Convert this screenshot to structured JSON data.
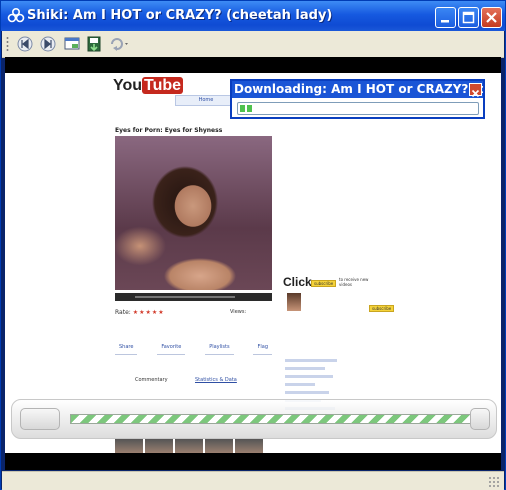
{
  "window": {
    "title": "Shiki: Am I HOT or CRAZY? (cheetah lady)"
  },
  "toolbar": {
    "icons": [
      "prev-icon",
      "next-icon",
      "picture-in-picture-icon",
      "save-icon",
      "refresh-icon"
    ]
  },
  "video_frame": {
    "logo_you": "You",
    "logo_tube": "Tube",
    "heading": "Eyes for Porn: Eyes for Shyness",
    "nav_tab": "Home",
    "rating_label": "Rate:",
    "stars": "★★★★★",
    "views_label": "Views:",
    "actions": [
      "Share",
      "Favorite",
      "Playlists",
      "Flag"
    ],
    "commentary": "Commentary",
    "statistics": "Statistics & Data",
    "click_text": "Click",
    "subscribe": "subscribe",
    "new_videos": "to receive new videos"
  },
  "download": {
    "title": "Downloading: Am I HOT or CRAZY? (che...",
    "progress": 0.05
  },
  "colors": {
    "titlebar": "#1659e0",
    "progress_fill": "#4fc24f"
  }
}
